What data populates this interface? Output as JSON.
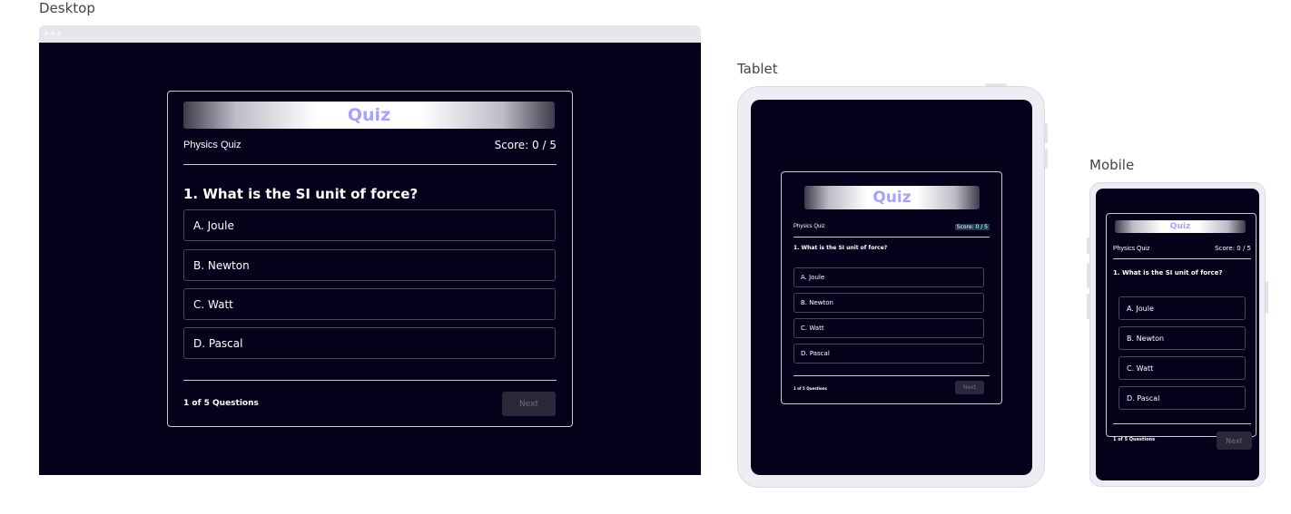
{
  "labels": {
    "desktop": "Desktop",
    "tablet": "Tablet",
    "mobile": "Mobile"
  },
  "quiz": {
    "banner_title": "Quiz",
    "quiz_name": "Physics Quiz",
    "score": "Score: 0 / 5",
    "question": "1. What is the SI unit of force?",
    "options": [
      "A. Joule",
      "B. Newton",
      "C. Watt",
      "D. Pascal"
    ],
    "progress": "1 of 5 Questions",
    "next_label": "Next"
  },
  "colors": {
    "screen_bg": "#06011a",
    "banner_text": "#a5a3ff",
    "card_border": "#c9c8d6",
    "option_border": "#4a4858",
    "next_bg": "#2a2838",
    "next_text": "#6f6d80"
  }
}
